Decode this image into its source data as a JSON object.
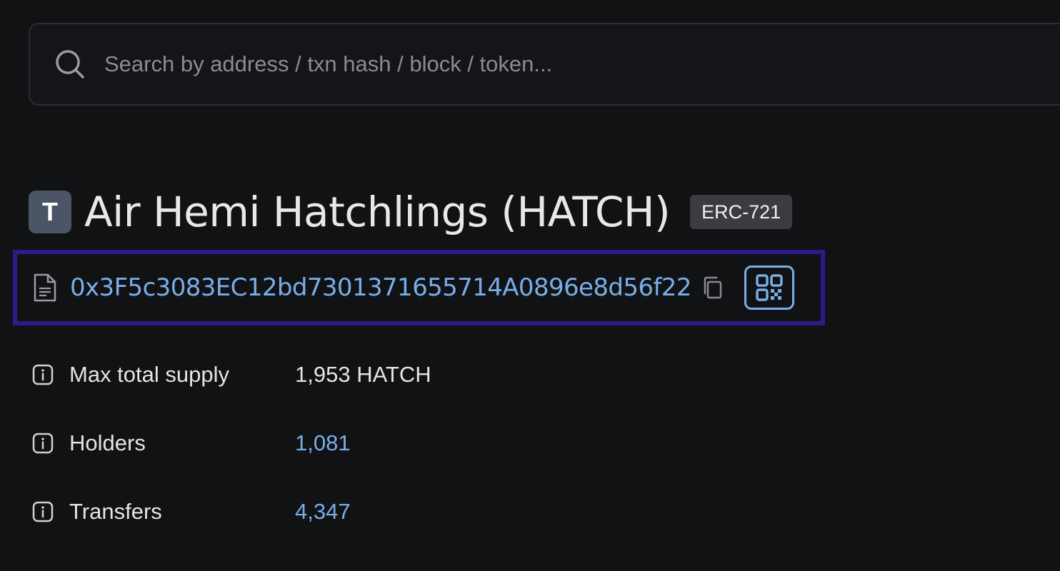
{
  "search": {
    "placeholder": "Search by address / txn hash / block / token..."
  },
  "token": {
    "avatar_letter": "T",
    "title": "Air Hemi Hatchlings (HATCH)",
    "type_badge": "ERC-721",
    "address": "0x3F5c3083EC12bd7301371655714A0896e8d56f22"
  },
  "details": {
    "max_supply": {
      "label": "Max total supply",
      "value": "1,953 HATCH"
    },
    "holders": {
      "label": "Holders",
      "value": "1,081"
    },
    "transfers": {
      "label": "Transfers",
      "value": "4,347"
    }
  },
  "colors": {
    "background": "#111214",
    "link": "#78aee8",
    "highlight_border": "#2b1c89",
    "badge_bg": "#3a3c41",
    "avatar_bg": "#4b5565"
  },
  "icons": [
    "search-icon",
    "contract-document-icon",
    "copy-icon",
    "qr-code-icon",
    "info-icon"
  ]
}
